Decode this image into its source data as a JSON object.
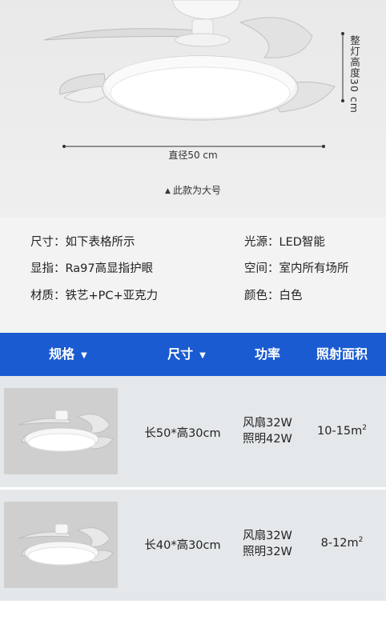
{
  "product_image": {
    "height_label": "整灯高度30 cm",
    "diameter_label": "直径50 cm",
    "size_note": "此款为大号"
  },
  "specs": {
    "left": [
      {
        "label": "尺寸：",
        "value": "如下表格所示"
      },
      {
        "label": "显指：",
        "value": "Ra97高显指护眼"
      },
      {
        "label": "材质：",
        "value": "铁艺+PC+亚克力"
      }
    ],
    "right": [
      {
        "label": "光源：",
        "value": "LED智能"
      },
      {
        "label": "空间：",
        "value": "室内所有场所"
      },
      {
        "label": "颜色：",
        "value": "白色"
      }
    ]
  },
  "table": {
    "headers": [
      "规格",
      "尺寸",
      "功率",
      "照射面积"
    ],
    "rows": [
      {
        "size": "长50*高30cm",
        "power_fan": "风扇32W",
        "power_light": "照明42W",
        "area": "10-15m",
        "area_unit_sup": "2"
      },
      {
        "size": "长40*高30cm",
        "power_fan": "风扇32W",
        "power_light": "照明32W",
        "area": "8-12m",
        "area_unit_sup": "2"
      }
    ]
  },
  "colors": {
    "header_blue": "#1a5bd1",
    "row_bg": "#e4e8eb",
    "hero_bg": "#ececec"
  }
}
